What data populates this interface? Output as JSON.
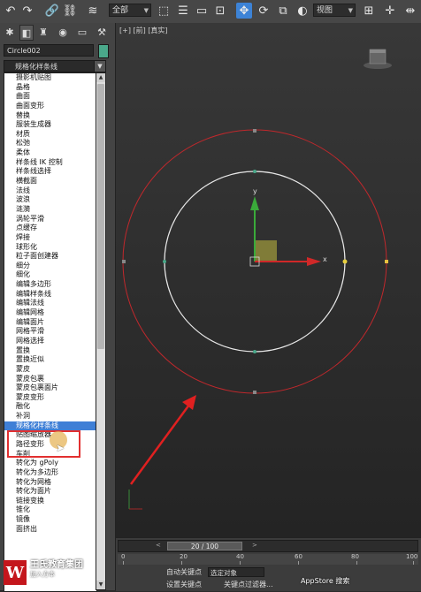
{
  "toolbar": {
    "selection_filter": "全部",
    "ref_coord": "视图",
    "icons": [
      "undo-icon",
      "redo-icon",
      "link-icon",
      "unlink-icon",
      "bind-spacewarp-icon",
      "select-icon",
      "select-by-name-icon",
      "rect-region-icon",
      "window-crossing-icon",
      "move-icon",
      "rotate-icon",
      "scale-icon",
      "ref-coord-icon",
      "pivot-icon",
      "snap-icon",
      "mirror-icon"
    ]
  },
  "command_panel": {
    "tab_icons": [
      "create-icon",
      "modify-icon",
      "hierarchy-icon",
      "motion-icon",
      "display-icon",
      "utilities-icon"
    ],
    "object_name": "Circle002",
    "object_color": "#4aa88a",
    "modifier_dropdown": "规格化样条线",
    "modifiers": [
      "摄影机贴图",
      "晶格",
      "曲面",
      "曲面变形",
      "替换",
      "服装生成器",
      "材质",
      "松弛",
      "柔体",
      "样条线 IK 控制",
      "样条线选择",
      "横截面",
      "法线",
      "波浪",
      "涟漪",
      "涡轮平滑",
      "点缓存",
      "焊接",
      "球形化",
      "粒子面创建器",
      "细分",
      "细化",
      "编辑多边形",
      "编辑样条线",
      "编辑法线",
      "编辑网格",
      "编辑面片",
      "网格平滑",
      "网格选择",
      "置换",
      "置换近似",
      "蒙皮",
      "蒙皮包裹",
      "蒙皮包裹面片",
      "蒙皮变形",
      "融化",
      "补洞",
      "规格化样条线",
      "贴图缩放器",
      "路径变形",
      "车削",
      "转化为 gPoly",
      "转化为多边形",
      "转化为网格",
      "转化为面片",
      "链接变换",
      "锥化",
      "镜像",
      "面挤出"
    ],
    "selected_index": 37
  },
  "viewport": {
    "label": "[+] [前] [真实]",
    "axis_x": "x",
    "axis_y": "y",
    "inner_circle_color": "#e8e8e8",
    "outer_circle_color": "#c0282c"
  },
  "timeline": {
    "frame_display": "20 / 100",
    "ticks": [
      "0",
      "20",
      "40",
      "60",
      "80",
      "100"
    ],
    "auto_key": "自动关键点",
    "set_key": "设置关键点",
    "selected_object": "选定对象",
    "key_filters": "关键点过滤器..."
  },
  "watermark": {
    "logo": "W",
    "company": "王氏教育集团",
    "tagline": "加入方本",
    "frame_field": "20",
    "appstore_text": "AppStore 搜索"
  }
}
